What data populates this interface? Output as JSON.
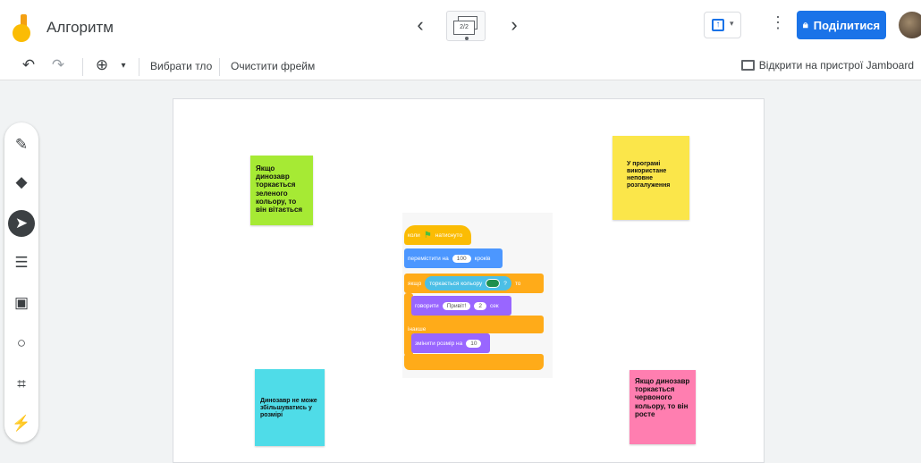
{
  "header": {
    "app_title": "Алгоритм",
    "frame_indicator": "2/2",
    "share_label": "Поділитися"
  },
  "toolbar": {
    "set_background": "Вибрати тло",
    "clear_frame": "Очистити фрейм",
    "open_on_jamboard": "Відкрити на пристрої Jamboard"
  },
  "tools": [
    "pen-icon",
    "eraser-icon",
    "select-icon",
    "sticky-note-icon",
    "image-icon",
    "circle-icon",
    "textbox-icon",
    "laser-icon"
  ],
  "notes": [
    {
      "text": "Якщо динозавр торкається зеленого кольору, то він вітається",
      "color": "#a6ea34"
    },
    {
      "text": "У програмі використане неповне розгалуження",
      "color": "#fbe64a"
    },
    {
      "text": "Динозавр не може збільшуватись у розмірі",
      "color": "#4fdce8"
    },
    {
      "text": "Якщо динозавр торкається червоного кольору, то він росте",
      "color": "#ff7eb0"
    }
  ],
  "scratch": {
    "when_flag": "коли",
    "when_flag_suffix": "натиснуто",
    "move_label": "перемістити на",
    "move_value": "100",
    "move_suffix": "кроків",
    "if_label": "якщо",
    "touch_label": "торкається кольору",
    "question": "?",
    "then_label": "то",
    "say_label": "говорити",
    "say_value": "Привіт!",
    "say_secs": "2",
    "say_suffix": "сек",
    "else_label": "інакше",
    "resize_label": "змінити розмір на",
    "resize_value": "10"
  },
  "colors": {
    "accent": "#1a73e8",
    "event": "#fbbc04",
    "motion": "#4c97ff",
    "control": "#ffab19",
    "looks": "#9966ff",
    "sensing": "#4cbfe6"
  }
}
